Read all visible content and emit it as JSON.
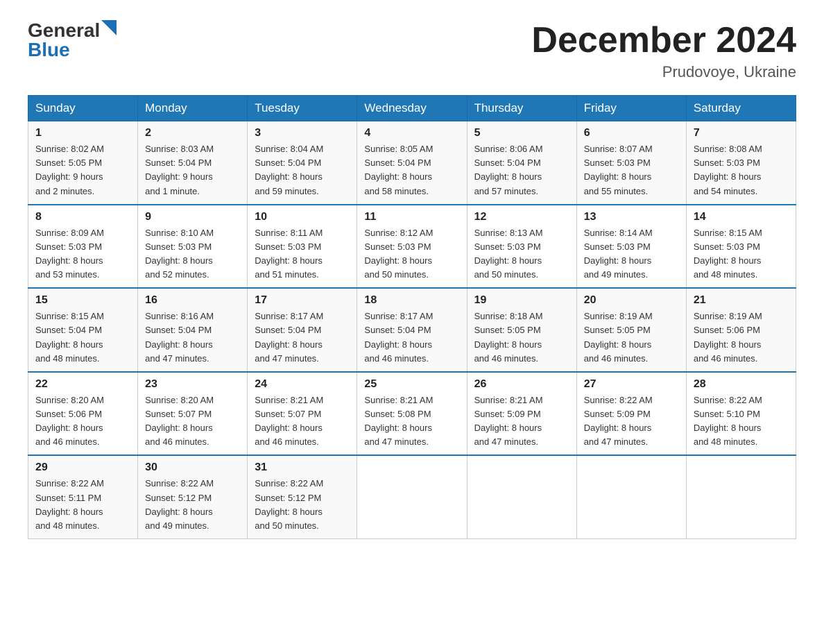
{
  "logo": {
    "general": "General",
    "blue": "Blue"
  },
  "title": "December 2024",
  "location": "Prudovoye, Ukraine",
  "days_of_week": [
    "Sunday",
    "Monday",
    "Tuesday",
    "Wednesday",
    "Thursday",
    "Friday",
    "Saturday"
  ],
  "weeks": [
    [
      {
        "day": "1",
        "sunrise": "8:02 AM",
        "sunset": "5:05 PM",
        "daylight": "9 hours and 2 minutes."
      },
      {
        "day": "2",
        "sunrise": "8:03 AM",
        "sunset": "5:04 PM",
        "daylight": "9 hours and 1 minute."
      },
      {
        "day": "3",
        "sunrise": "8:04 AM",
        "sunset": "5:04 PM",
        "daylight": "8 hours and 59 minutes."
      },
      {
        "day": "4",
        "sunrise": "8:05 AM",
        "sunset": "5:04 PM",
        "daylight": "8 hours and 58 minutes."
      },
      {
        "day": "5",
        "sunrise": "8:06 AM",
        "sunset": "5:04 PM",
        "daylight": "8 hours and 57 minutes."
      },
      {
        "day": "6",
        "sunrise": "8:07 AM",
        "sunset": "5:03 PM",
        "daylight": "8 hours and 55 minutes."
      },
      {
        "day": "7",
        "sunrise": "8:08 AM",
        "sunset": "5:03 PM",
        "daylight": "8 hours and 54 minutes."
      }
    ],
    [
      {
        "day": "8",
        "sunrise": "8:09 AM",
        "sunset": "5:03 PM",
        "daylight": "8 hours and 53 minutes."
      },
      {
        "day": "9",
        "sunrise": "8:10 AM",
        "sunset": "5:03 PM",
        "daylight": "8 hours and 52 minutes."
      },
      {
        "day": "10",
        "sunrise": "8:11 AM",
        "sunset": "5:03 PM",
        "daylight": "8 hours and 51 minutes."
      },
      {
        "day": "11",
        "sunrise": "8:12 AM",
        "sunset": "5:03 PM",
        "daylight": "8 hours and 50 minutes."
      },
      {
        "day": "12",
        "sunrise": "8:13 AM",
        "sunset": "5:03 PM",
        "daylight": "8 hours and 50 minutes."
      },
      {
        "day": "13",
        "sunrise": "8:14 AM",
        "sunset": "5:03 PM",
        "daylight": "8 hours and 49 minutes."
      },
      {
        "day": "14",
        "sunrise": "8:15 AM",
        "sunset": "5:03 PM",
        "daylight": "8 hours and 48 minutes."
      }
    ],
    [
      {
        "day": "15",
        "sunrise": "8:15 AM",
        "sunset": "5:04 PM",
        "daylight": "8 hours and 48 minutes."
      },
      {
        "day": "16",
        "sunrise": "8:16 AM",
        "sunset": "5:04 PM",
        "daylight": "8 hours and 47 minutes."
      },
      {
        "day": "17",
        "sunrise": "8:17 AM",
        "sunset": "5:04 PM",
        "daylight": "8 hours and 47 minutes."
      },
      {
        "day": "18",
        "sunrise": "8:17 AM",
        "sunset": "5:04 PM",
        "daylight": "8 hours and 46 minutes."
      },
      {
        "day": "19",
        "sunrise": "8:18 AM",
        "sunset": "5:05 PM",
        "daylight": "8 hours and 46 minutes."
      },
      {
        "day": "20",
        "sunrise": "8:19 AM",
        "sunset": "5:05 PM",
        "daylight": "8 hours and 46 minutes."
      },
      {
        "day": "21",
        "sunrise": "8:19 AM",
        "sunset": "5:06 PM",
        "daylight": "8 hours and 46 minutes."
      }
    ],
    [
      {
        "day": "22",
        "sunrise": "8:20 AM",
        "sunset": "5:06 PM",
        "daylight": "8 hours and 46 minutes."
      },
      {
        "day": "23",
        "sunrise": "8:20 AM",
        "sunset": "5:07 PM",
        "daylight": "8 hours and 46 minutes."
      },
      {
        "day": "24",
        "sunrise": "8:21 AM",
        "sunset": "5:07 PM",
        "daylight": "8 hours and 46 minutes."
      },
      {
        "day": "25",
        "sunrise": "8:21 AM",
        "sunset": "5:08 PM",
        "daylight": "8 hours and 47 minutes."
      },
      {
        "day": "26",
        "sunrise": "8:21 AM",
        "sunset": "5:09 PM",
        "daylight": "8 hours and 47 minutes."
      },
      {
        "day": "27",
        "sunrise": "8:22 AM",
        "sunset": "5:09 PM",
        "daylight": "8 hours and 47 minutes."
      },
      {
        "day": "28",
        "sunrise": "8:22 AM",
        "sunset": "5:10 PM",
        "daylight": "8 hours and 48 minutes."
      }
    ],
    [
      {
        "day": "29",
        "sunrise": "8:22 AM",
        "sunset": "5:11 PM",
        "daylight": "8 hours and 48 minutes."
      },
      {
        "day": "30",
        "sunrise": "8:22 AM",
        "sunset": "5:12 PM",
        "daylight": "8 hours and 49 minutes."
      },
      {
        "day": "31",
        "sunrise": "8:22 AM",
        "sunset": "5:12 PM",
        "daylight": "8 hours and 50 minutes."
      },
      null,
      null,
      null,
      null
    ]
  ],
  "labels": {
    "sunrise": "Sunrise:",
    "sunset": "Sunset:",
    "daylight": "Daylight:"
  }
}
